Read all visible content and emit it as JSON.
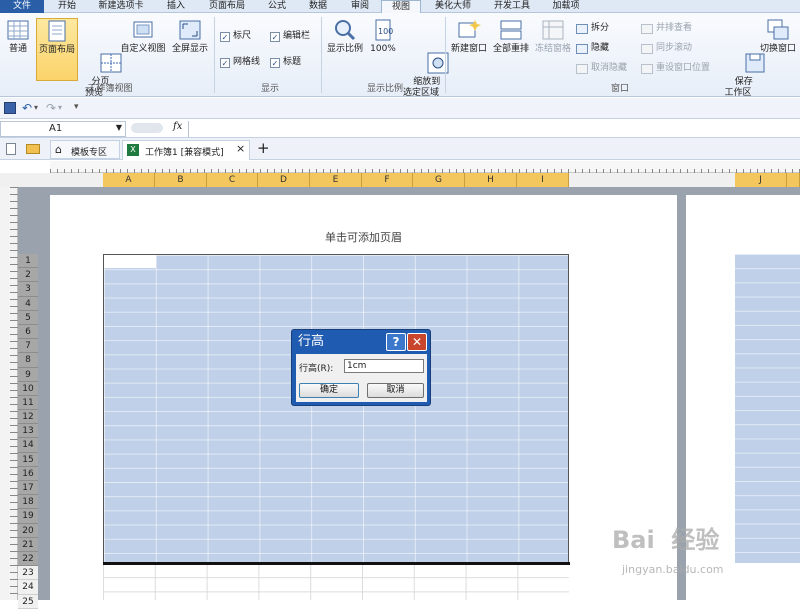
{
  "ribbon_tabs": [
    "文件",
    "开始",
    "新建选项卡",
    "插入",
    "页面布局",
    "公式",
    "数据",
    "审阅",
    "视图",
    "美化大师",
    "开发工具",
    "加载项"
  ],
  "active_tab": "视图",
  "groups": {
    "workbook_views": {
      "label": "工作簿视图",
      "normal": "普通",
      "page_layout": "页面布局",
      "page_break": "分页\n预览",
      "custom_views": "自定义视图",
      "full_screen": "全屏显示"
    },
    "show": {
      "label": "显示",
      "ruler": "标尺",
      "formula_bar": "编辑栏",
      "gridlines": "网格线",
      "headings": "标题"
    },
    "zoom": {
      "label": "显示比例",
      "zoom": "显示比例",
      "hundred": "100%",
      "zoom_to_selection": "缩放到\n选定区域"
    },
    "window": {
      "label": "窗口",
      "new_window": "新建窗口",
      "arrange_all": "全部重排",
      "freeze_panes": "冻结窗格",
      "split": "拆分",
      "hide": "隐藏",
      "unhide": "取消隐藏",
      "side_by_side": "并排查看",
      "sync_scroll": "同步滚动",
      "reset_position": "重设窗口位置",
      "save_workspace": "保存\n工作区",
      "switch_windows": "切换窗口"
    }
  },
  "name_box": "A1",
  "fx": "fx",
  "book_tabs": {
    "template": "模板专区",
    "workbook": "工作簿1 [兼容模式]",
    "close": "×",
    "add": "+"
  },
  "columns": [
    "A",
    "B",
    "C",
    "D",
    "E",
    "F",
    "G",
    "H",
    "I"
  ],
  "page2_column": "J",
  "rows": [
    "1",
    "2",
    "3",
    "4",
    "5",
    "6",
    "7",
    "8",
    "9",
    "10",
    "11",
    "12",
    "13",
    "14",
    "15",
    "16",
    "17",
    "18",
    "19",
    "20",
    "21",
    "22",
    "23",
    "24",
    "25"
  ],
  "header_placeholder": "单击可添加页眉",
  "dialog": {
    "title": "行高",
    "help": "?",
    "close": "✕",
    "label": "行高(R):",
    "value": "1cm",
    "ok": "确定",
    "cancel": "取消"
  },
  "watermark": {
    "brand": "Bai  经验",
    "url": "jingyan.baidu.com"
  },
  "colors": {
    "file_tab": "#2a5fa8",
    "selection": "#bfd0e8",
    "column_highlight": "#f4c75e",
    "dialog": "#1f5bb0"
  }
}
